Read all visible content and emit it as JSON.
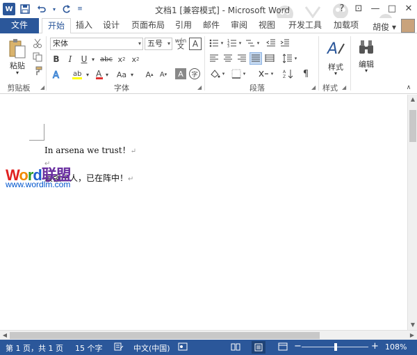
{
  "titlebar": {
    "title": "文档1 [兼容模式] - Microsoft Word",
    "app_logo": "W",
    "help": "?",
    "ribbon_display": "⊡",
    "minimize": "—",
    "restore": "□",
    "close": "✕"
  },
  "tabs": [
    {
      "label": "文件"
    },
    {
      "label": "开始"
    },
    {
      "label": "插入"
    },
    {
      "label": "设计"
    },
    {
      "label": "页面布局"
    },
    {
      "label": "引用"
    },
    {
      "label": "邮件"
    },
    {
      "label": "审阅"
    },
    {
      "label": "视图"
    },
    {
      "label": "开发工具"
    },
    {
      "label": "加载项"
    }
  ],
  "user": {
    "name": "胡俊 ▾"
  },
  "ribbon": {
    "clipboard": {
      "label": "剪贴板",
      "paste": "粘贴"
    },
    "font": {
      "label": "字体",
      "font_name": "宋体",
      "font_size": "五号",
      "wen": "wén",
      "a_box": "A"
    },
    "paragraph": {
      "label": "段落"
    },
    "styles": {
      "label": "样式",
      "button": "样式"
    },
    "editing": {
      "button": "编辑"
    }
  },
  "document": {
    "line1": "In arsena we trust！",
    "line2": "最强三人，已在阵中！",
    "para_mark": "↵"
  },
  "watermark": {
    "brand_word": "Word",
    "brand_cn": "联盟",
    "url": "www.wordlm.com"
  },
  "statusbar": {
    "page": "第 1 页，共 1 页",
    "words": "15 个字",
    "language": "中文(中国)",
    "zoom": "108%",
    "zoom_minus": "−",
    "zoom_plus": "+"
  },
  "colors": {
    "accent": "#2b579a",
    "watermark_blue": "#0055cc"
  }
}
